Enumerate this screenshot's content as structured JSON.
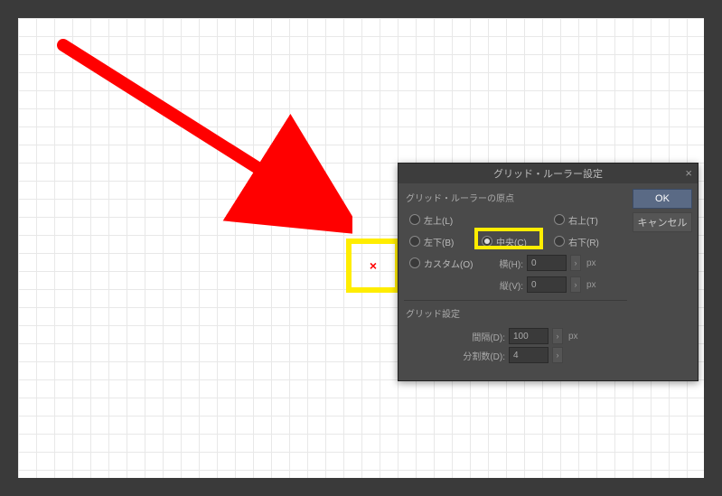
{
  "canvas": {
    "center_marker": "×"
  },
  "dialog": {
    "title": "グリッド・ルーラー設定",
    "ok": "OK",
    "cancel": "キャンセル",
    "origin": {
      "group_label": "グリッド・ルーラーの原点",
      "top_left": "左上(L)",
      "top_right": "右上(T)",
      "bottom_left": "左下(B)",
      "center": "中央(C)",
      "bottom_right": "右下(R)",
      "custom": "カスタム(O)",
      "h_label": "横(H):",
      "h_value": "0",
      "v_label": "縦(V):",
      "v_value": "0",
      "unit": "px"
    },
    "grid": {
      "group_label": "グリッド設定",
      "spacing_label": "間隔(D):",
      "spacing_value": "100",
      "division_label": "分割数(D):",
      "division_value": "4",
      "unit": "px"
    }
  }
}
